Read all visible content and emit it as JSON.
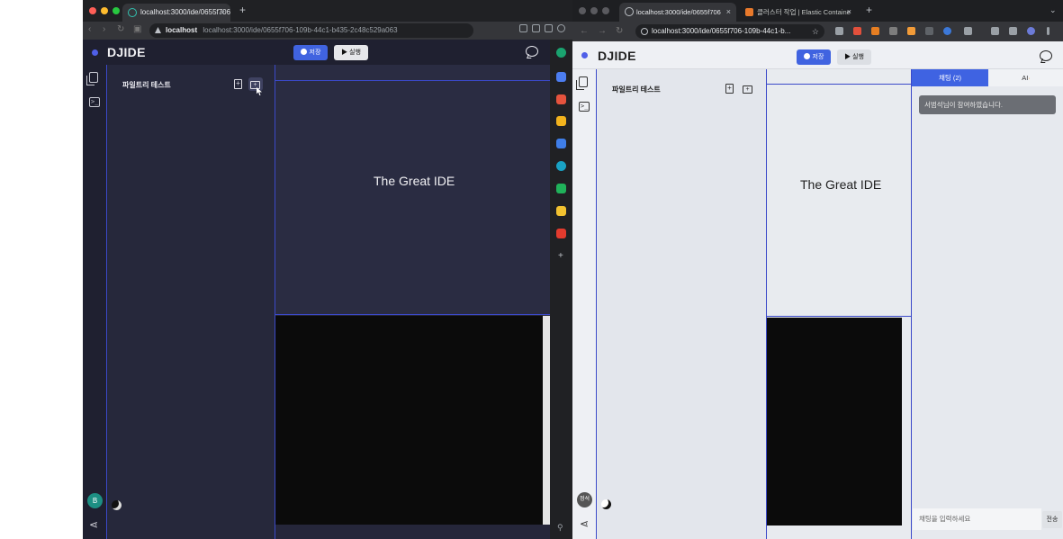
{
  "left_window": {
    "tab": {
      "title": "localhost:3000/ide/0655f706",
      "close": "×"
    },
    "newtab": "+",
    "address": {
      "host": "localhost",
      "url": "localhost:3000/ide/0655f706-109b-44c1-b435-2c48c529a063"
    },
    "app": {
      "title": "DJIDE",
      "save_label": "저장",
      "run_label": "실행",
      "explorer_title": "파일트리 테스트",
      "editor_title": "The Great IDE",
      "avatar_initial": "B"
    }
  },
  "right_window": {
    "tabs": [
      {
        "title": "localhost:3000/ide/0655f706",
        "close": "×"
      },
      {
        "title": "클러스터 작업 | Elastic Containe",
        "close": "×"
      }
    ],
    "newtab": "+",
    "address": {
      "url": "localhost:3000/ide/0655f706-109b-44c1-b..."
    },
    "app": {
      "title": "DJIDE",
      "save_label": "저장",
      "run_label": "실행",
      "explorer_title": "파일트리 테스트",
      "editor_title": "The Great IDE",
      "avatar_label": "정석",
      "chat": {
        "tab_chat": "채팅 (2)",
        "tab_ai": "AI",
        "message": "서범석님이 참여하였습니다.",
        "input_placeholder": "채팅을 입력하세요",
        "send_label": "전송"
      }
    }
  },
  "colors": {
    "accent": "#4063e0",
    "panel_border": "#3b49c9",
    "dark_bg": "#25263a",
    "light_bg": "#e8ebef"
  },
  "icons": [
    "files-icon",
    "terminal-icon",
    "chat-icon",
    "new-file-icon",
    "new-folder-icon",
    "share-icon",
    "dark-mode-icon",
    "lock-icon",
    "info-icon",
    "star-icon"
  ]
}
